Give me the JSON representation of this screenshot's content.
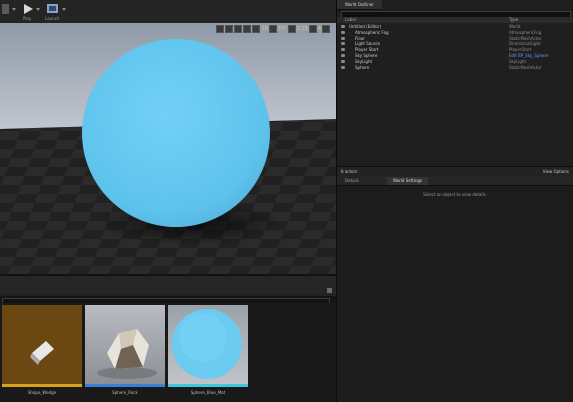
{
  "toolbar": {
    "buttons": [
      {
        "name": "settings-button",
        "label": ""
      },
      {
        "name": "play-button",
        "label": "Play"
      },
      {
        "name": "launch-button",
        "label": "Launch"
      }
    ]
  },
  "viewport": {
    "grid_snap_value": "10",
    "rotation_snap_value": "10°",
    "scale_snap_value": "0.25",
    "camera_speed": "4"
  },
  "outliner": {
    "tab_label": "World Outliner",
    "col_label": "Label",
    "col_type": "Type",
    "rows": [
      {
        "name": "Untitled (Editor)",
        "type": "World",
        "indent": 0
      },
      {
        "name": "Atmospheric Fog",
        "type": "AtmosphericFog",
        "indent": 1
      },
      {
        "name": "Floor",
        "type": "StaticMeshActor",
        "indent": 1
      },
      {
        "name": "Light Source",
        "type": "DirectionalLight",
        "indent": 1
      },
      {
        "name": "Player Start",
        "type": "PlayerStart",
        "indent": 1
      },
      {
        "name": "Sky Sphere",
        "type": "Edit BP_Sky_Sphere",
        "indent": 1,
        "link": true
      },
      {
        "name": "SkyLight",
        "type": "SkyLight",
        "indent": 1
      },
      {
        "name": "Sphere",
        "type": "StaticMeshActor",
        "indent": 1
      }
    ],
    "status": "8 actors",
    "view_options": "View Options"
  },
  "details": {
    "tabs": [
      "Details",
      "World Settings"
    ],
    "hint": "Select an object to view details."
  },
  "content_browser": {
    "assets": [
      {
        "label": "Shape_Wedge",
        "bar_color": "#d9a21e"
      },
      {
        "label": "Sphere_Rock",
        "bar_color": "#3b7fd9"
      },
      {
        "label": "Sphere_Blue_Mat",
        "bar_color": "#3fc7e0"
      }
    ]
  },
  "colors": {
    "sphere": "#66c8f0",
    "outliner_link": "#5aa0ff",
    "wedge_bg": "#6b4712"
  }
}
